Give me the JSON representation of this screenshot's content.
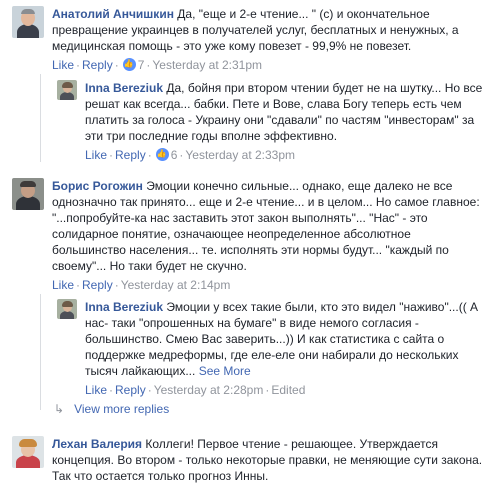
{
  "comments": [
    {
      "name": "Анатолий Анчишкин",
      "text": "Да, \"еще и 2-е чтение... \" (с) и окончательное превращение украинцев в получателей услуг, бесплатных и ненужных, а медицинская помощь - это уже кому повезет - 99,9% не повезет.",
      "like": "Like",
      "reply": "Reply",
      "likes": "7",
      "time": "Yesterday at 2:31pm"
    },
    {
      "name": "Inna Bereziuk",
      "text": "Да, бойня при втором чтении будет не на шутку... Но все решат как всегда... бабки. Пете и Вове, слава Богу теперь есть чем платить за голоса - Украину они \"сдавали\" по частям \"инвесторам\" за эти три последние годы вполне эффективно.",
      "like": "Like",
      "reply": "Reply",
      "likes": "6",
      "time": "Yesterday at 2:33pm"
    },
    {
      "name": "Борис Рогожин",
      "text": "Эмоции конечно сильные... однако, еще далеко не все однозначно так принято... еще и 2-е чтение... и в целом... Но самое главное: \"...попробуйте-ка нас заставить этот закон выполнять\"... \"Нас\" - это солидарное понятие, означающее неопределенное абсолютное большинство населения... те. исполнять эти нормы будут... \"каждый по своему\"... Но таки будет не скучно.",
      "like": "Like",
      "reply": "Reply",
      "time": "Yesterday at 2:14pm"
    },
    {
      "name": "Inna Bereziuk",
      "text": "Эмоции у всех такие были, кто это видел \"наживо\"...(( А нас- таки \"опрошенных на бумаге\" в виде немого согласия - большинство. Смею Вас заверить...)) И как статистика с сайта о поддержке медреформы, где еле-еле они набирали до нескольких тысяч лайкающих...",
      "see_more": "See More",
      "like": "Like",
      "reply": "Reply",
      "time": "Yesterday at 2:28pm",
      "edited": "Edited"
    },
    {
      "name": "Лехан Валерия",
      "text": "Коллеги! Первое чтение - решающее. Утверждается концепция. Во втором - только некоторые правки, не меняющие сути закона. Так что остается только прогноз Инны."
    }
  ],
  "view_more_replies": "View more replies",
  "colors": {
    "name": "#365899",
    "link": "#4267b2",
    "meta": "#90949c",
    "text": "#1d2129",
    "like_badge": "#5890ff"
  }
}
